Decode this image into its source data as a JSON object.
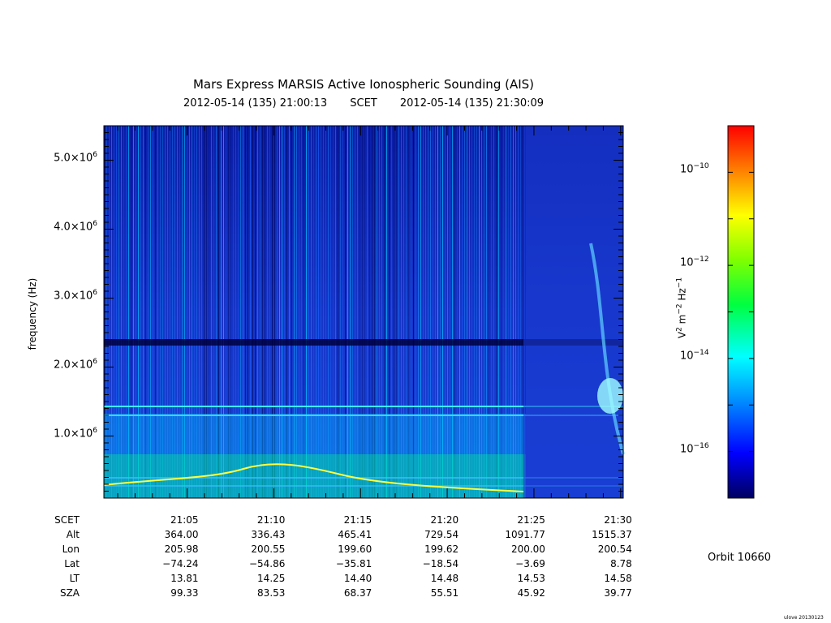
{
  "header": {
    "title": "Mars Express MARSIS Active Ionospheric Sounding (AIS)",
    "start": "2012-05-14 (135) 21:00:13",
    "mid": "SCET",
    "end": "2012-05-14 (135) 21:30:09"
  },
  "chart_data": {
    "type": "heatmap",
    "title": "Mars Express MARSIS Active Ionospheric Sounding (AIS)",
    "xlabel": "SCET",
    "ylabel": "frequency (Hz)",
    "x_ticks": [
      "21:05",
      "21:10",
      "21:15",
      "21:20",
      "21:25",
      "21:30"
    ],
    "y_ticks": [
      {
        "value": 1000000,
        "mant": "1.0×10",
        "exp": "6"
      },
      {
        "value": 2000000,
        "mant": "2.0×10",
        "exp": "6"
      },
      {
        "value": 3000000,
        "mant": "3.0×10",
        "exp": "6"
      },
      {
        "value": 4000000,
        "mant": "4.0×10",
        "exp": "6"
      },
      {
        "value": 5000000,
        "mant": "5.0×10",
        "exp": "6"
      }
    ],
    "ylim": [
      100000,
      5500000
    ],
    "xlim_minutes": [
      0.2,
      30.15
    ],
    "colorbar": {
      "label_parts": [
        "V",
        "2",
        " m",
        "−2",
        " Hz",
        "−1"
      ],
      "scale": "log",
      "range_exp": [
        -17,
        -9
      ],
      "ticks": [
        {
          "mant": "10",
          "exp": "−10"
        },
        {
          "mant": "10",
          "exp": "−12"
        },
        {
          "mant": "10",
          "exp": "−14"
        },
        {
          "mant": "10",
          "exp": "−16"
        }
      ],
      "colormap": [
        "#000080",
        "#0000ff",
        "#00a0ff",
        "#00ffff",
        "#00ff40",
        "#80ff00",
        "#ffff00",
        "#ff8000",
        "#ff0000"
      ]
    }
  },
  "ephemeris": {
    "rows": [
      {
        "label": "SCET",
        "values": [
          "21:05",
          "21:10",
          "21:15",
          "21:20",
          "21:25",
          "21:30"
        ]
      },
      {
        "label": "Alt",
        "values": [
          "364.00",
          "336.43",
          "465.41",
          "729.54",
          "1091.77",
          "1515.37"
        ]
      },
      {
        "label": "Lon",
        "values": [
          "205.98",
          "200.55",
          "199.60",
          "199.62",
          "200.00",
          "200.54"
        ]
      },
      {
        "label": "Lat",
        "values": [
          "−74.24",
          "−54.86",
          "−35.81",
          "−18.54",
          "−3.69",
          "8.78"
        ]
      },
      {
        "label": "LT",
        "values": [
          "13.81",
          "14.25",
          "14.40",
          "14.48",
          "14.53",
          "14.58"
        ]
      },
      {
        "label": "SZA",
        "values": [
          "99.33",
          "83.53",
          "68.37",
          "55.51",
          "45.92",
          "39.77"
        ]
      }
    ]
  },
  "orbit_label": "Orbit 10660",
  "footer": "ulove 20130123"
}
